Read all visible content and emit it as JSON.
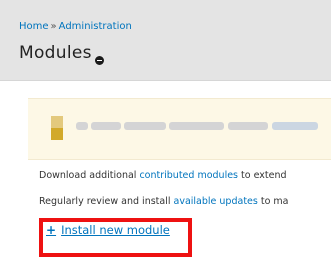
{
  "breadcrumb": {
    "home": "Home",
    "separator": "»",
    "current": "Administration"
  },
  "page": {
    "title": "Modules",
    "toggle_icon": "circle-minus-icon"
  },
  "notice": {
    "icon": "warning-icon"
  },
  "help": {
    "line1_prefix": "Download additional ",
    "line1_link": "contributed modules",
    "line1_suffix": " to extend",
    "line2_prefix": "Regularly review and install ",
    "line2_link": "available updates",
    "line2_suffix": " to ma"
  },
  "actions": {
    "install_plus": "+",
    "install_label": "Install new module"
  },
  "colors": {
    "link": "#0074bd",
    "highlight": "#ee1111",
    "header_bg": "#e4e4e4",
    "notice_bg": "#fdf8e6"
  }
}
